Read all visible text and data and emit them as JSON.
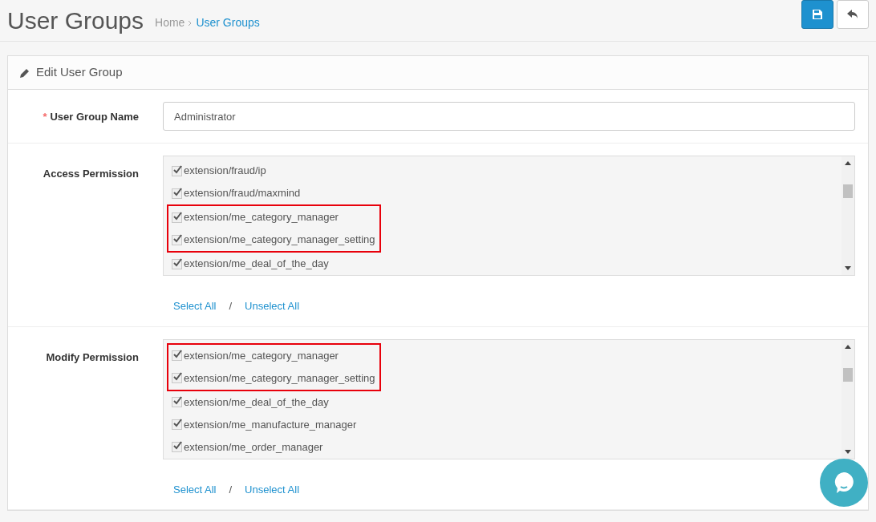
{
  "page": {
    "title": "User Groups",
    "breadcrumb": [
      {
        "label": "Home",
        "current": false
      },
      {
        "label": "User Groups",
        "current": true
      }
    ]
  },
  "actions": [
    {
      "kind": "save"
    },
    {
      "kind": "back"
    }
  ],
  "panel": {
    "title": "Edit User Group"
  },
  "name_field": {
    "label": "User Group Name",
    "required_mark": "*",
    "value": "Administrator"
  },
  "permissions": [
    {
      "label": "Access Permission",
      "items": [
        {
          "label": "extension/fraud/ip",
          "checked": true,
          "highlighted": false
        },
        {
          "label": "extension/fraud/maxmind",
          "checked": true,
          "highlighted": false
        },
        {
          "label": "extension/me_category_manager",
          "checked": true,
          "highlighted": true
        },
        {
          "label": "extension/me_category_manager_setting",
          "checked": true,
          "highlighted": true
        },
        {
          "label": "extension/me_deal_of_the_day",
          "checked": true,
          "highlighted": false
        }
      ],
      "select_all": "Select All",
      "separator": "/",
      "unselect_all": "Unselect All"
    },
    {
      "label": "Modify Permission",
      "items": [
        {
          "label": "extension/me_category_manager",
          "checked": true,
          "highlighted": true
        },
        {
          "label": "extension/me_category_manager_setting",
          "checked": true,
          "highlighted": true
        },
        {
          "label": "extension/me_deal_of_the_day",
          "checked": true,
          "highlighted": false
        },
        {
          "label": "extension/me_manufacture_manager",
          "checked": true,
          "highlighted": false
        },
        {
          "label": "extension/me_order_manager",
          "checked": true,
          "highlighted": false
        }
      ],
      "select_all": "Select All",
      "separator": "/",
      "unselect_all": "Unselect All"
    }
  ]
}
